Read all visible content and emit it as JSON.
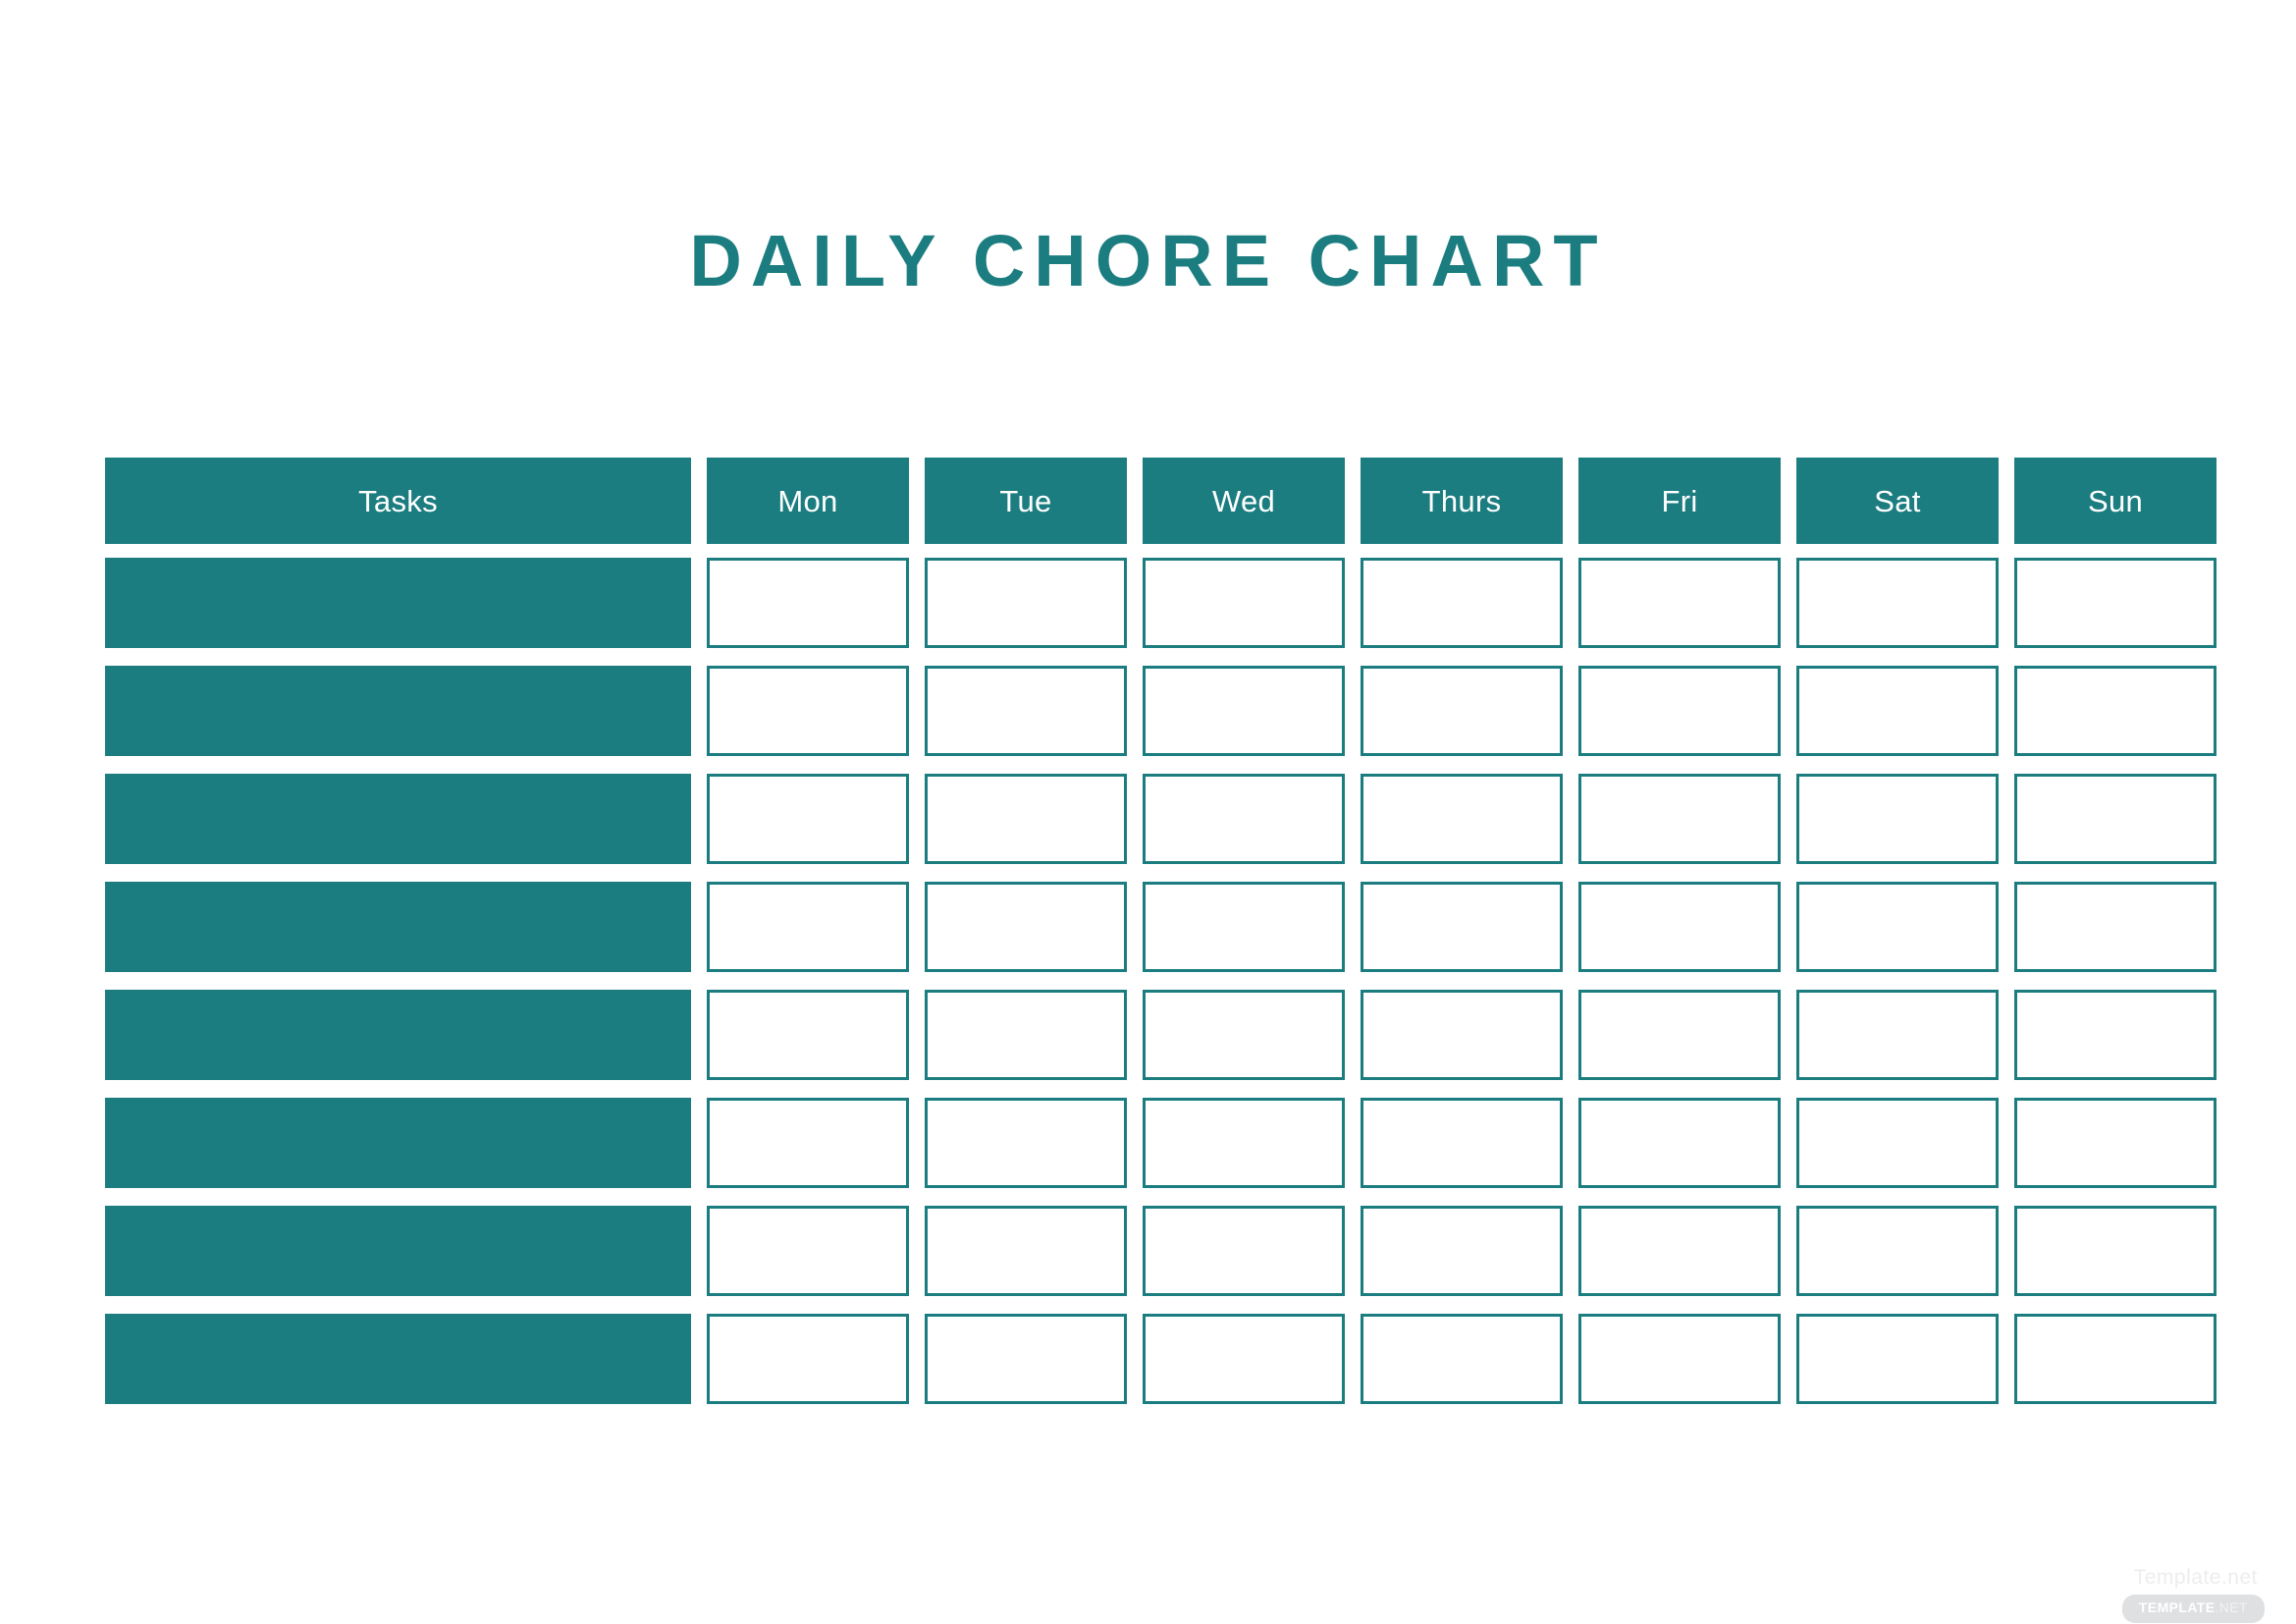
{
  "document": {
    "title": "DAILY CHORE CHART",
    "accent_color": "#1C7D80",
    "background_color": "#FFFFFF",
    "header_text_color": "#FFFFFF"
  },
  "chart_data": {
    "type": "table",
    "title": "DAILY CHORE CHART",
    "columns": [
      "Tasks",
      "Mon",
      "Tue",
      "Wed",
      "Thurs",
      "Fri",
      "Sat",
      "Sun"
    ],
    "row_count": 8,
    "rows": [
      {
        "task": "",
        "Mon": "",
        "Tue": "",
        "Wed": "",
        "Thurs": "",
        "Fri": "",
        "Sat": "",
        "Sun": ""
      },
      {
        "task": "",
        "Mon": "",
        "Tue": "",
        "Wed": "",
        "Thurs": "",
        "Fri": "",
        "Sat": "",
        "Sun": ""
      },
      {
        "task": "",
        "Mon": "",
        "Tue": "",
        "Wed": "",
        "Thurs": "",
        "Fri": "",
        "Sat": "",
        "Sun": ""
      },
      {
        "task": "",
        "Mon": "",
        "Tue": "",
        "Wed": "",
        "Thurs": "",
        "Fri": "",
        "Sat": "",
        "Sun": ""
      },
      {
        "task": "",
        "Mon": "",
        "Tue": "",
        "Wed": "",
        "Thurs": "",
        "Fri": "",
        "Sat": "",
        "Sun": ""
      },
      {
        "task": "",
        "Mon": "",
        "Tue": "",
        "Wed": "",
        "Thurs": "",
        "Fri": "",
        "Sat": "",
        "Sun": ""
      },
      {
        "task": "",
        "Mon": "",
        "Tue": "",
        "Wed": "",
        "Thurs": "",
        "Fri": "",
        "Sat": "",
        "Sun": ""
      },
      {
        "task": "",
        "Mon": "",
        "Tue": "",
        "Wed": "",
        "Thurs": "",
        "Fri": "",
        "Sat": "",
        "Sun": ""
      }
    ],
    "notes": "Blank printable weekly chore chart: first column is a filled teal task label block, the seven day columns are empty white check boxes outlined in teal.",
    "grid": false,
    "legend": false
  },
  "table": {
    "headers": {
      "tasks": "Tasks",
      "mon": "Mon",
      "tue": "Tue",
      "wed": "Wed",
      "thurs": "Thurs",
      "fri": "Fri",
      "sat": "Sat",
      "sun": "Sun"
    }
  },
  "watermark": {
    "text": "Template.net",
    "badge_strong": "TEMPLATE",
    "badge_light": ".NET"
  }
}
